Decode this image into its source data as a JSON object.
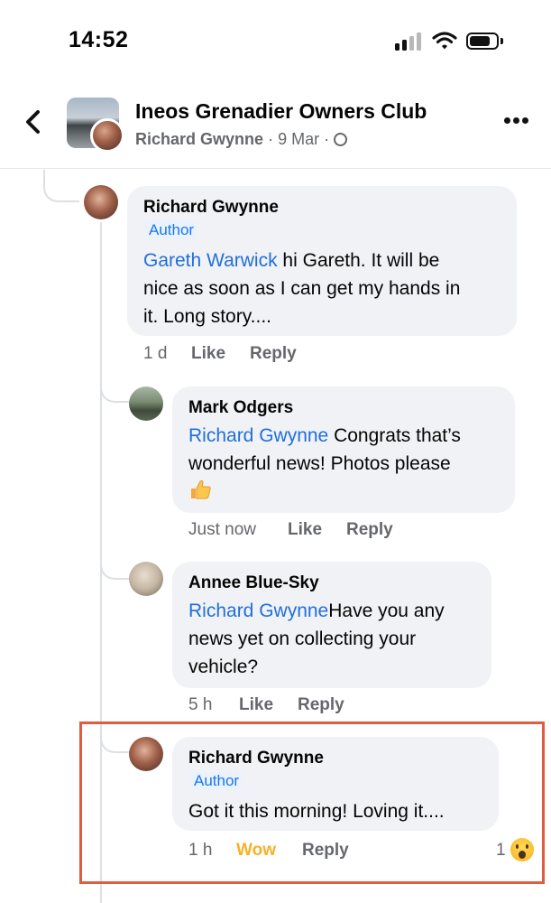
{
  "status_bar": {
    "time": "14:52"
  },
  "header": {
    "title": "Ineos Grenadier Owners Club",
    "poster": "Richard Gwynne",
    "separator": "·",
    "date": "9 Mar"
  },
  "comments": [
    {
      "author": "Richard Gwynne",
      "badge": "Author",
      "mention": "Gareth Warwick",
      "text_line1": " hi Gareth. It will be",
      "text_line2": "nice as soon as I can get my hands in",
      "text_line3": "it. Long story....",
      "time": "1 d",
      "like": "Like",
      "reply": "Reply"
    },
    {
      "author": "Mark Odgers",
      "mention": "Richard Gwynne",
      "text_line1": " Congrats that’s",
      "text_line2": "wonderful news!  Photos please",
      "time": "Just now",
      "like": "Like",
      "reply": "Reply"
    },
    {
      "author": "Annee Blue-Sky",
      "mention": "Richard Gwynne",
      "text_line1": "Have you any",
      "text_line2": "news yet on collecting your",
      "text_line3": "vehicle?",
      "time": "5 h",
      "like": "Like",
      "reply": "Reply"
    },
    {
      "author": "Richard Gwynne",
      "badge": "Author",
      "text_line1": "Got it this morning! Loving it....",
      "time": "1 h",
      "reaction": "Wow",
      "reply": "Reply",
      "reaction_count": "1",
      "reaction_icon": "wow-emoji-icon"
    }
  ],
  "colors": {
    "mention": "#216fdb",
    "author_badge": "#1877f2",
    "wow": "#f7b125",
    "highlight": "#e15b3e",
    "bubble": "#f0f2f5"
  }
}
